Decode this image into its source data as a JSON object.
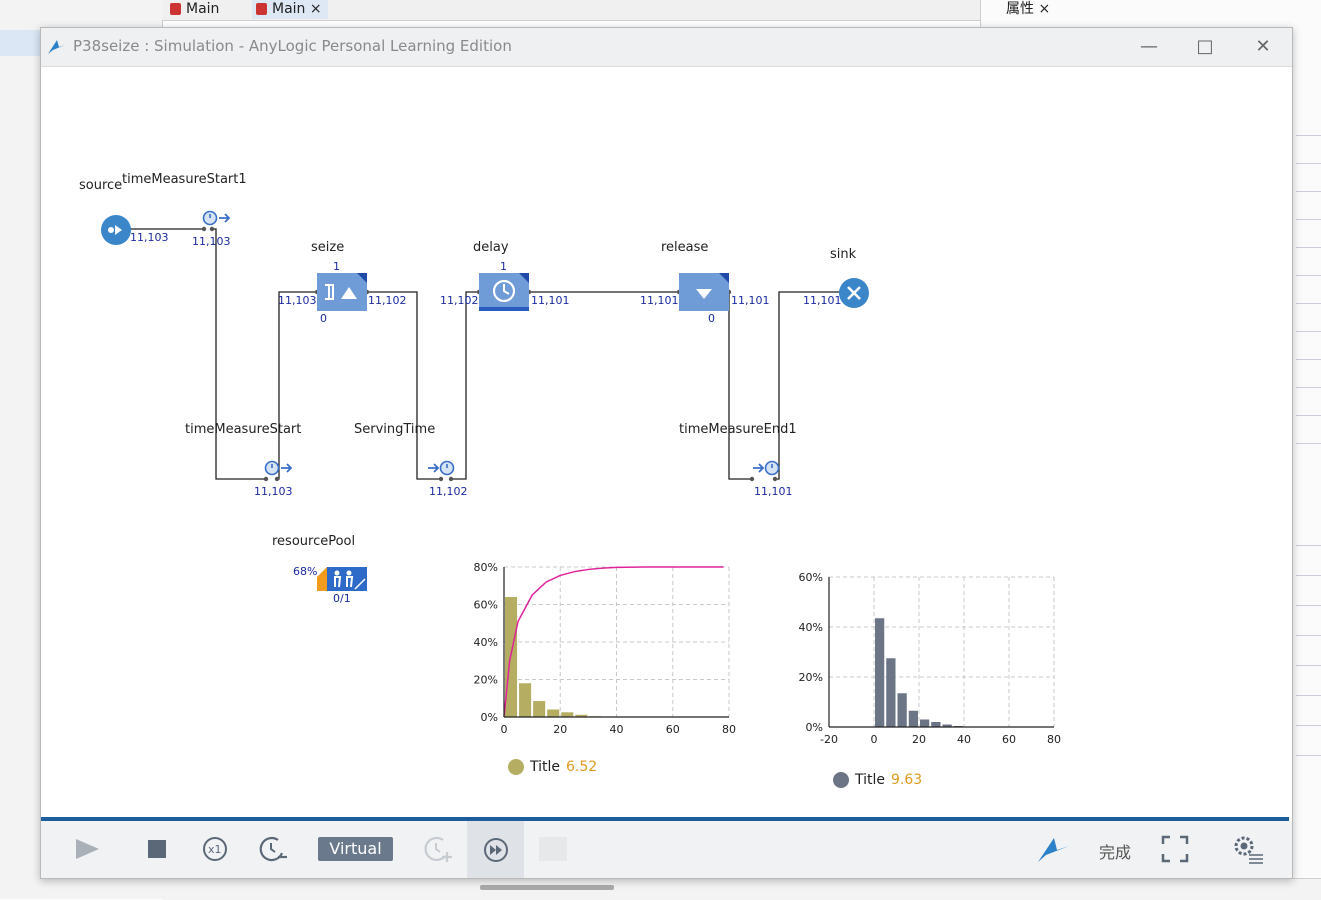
{
  "ide": {
    "tabs": [
      "Main",
      "Main"
    ],
    "right_tab": "属性"
  },
  "window": {
    "title": "P38seize : Simulation - AnyLogic Personal Learning Edition"
  },
  "blocks": {
    "source": {
      "label": "source",
      "count": "11,103"
    },
    "timeMeasureStart1": {
      "label": "timeMeasureStart1",
      "count": "11,103"
    },
    "seize": {
      "label": "seize",
      "top": "1",
      "in": "11,103",
      "out": "11,102",
      "bottom": "0"
    },
    "delay": {
      "label": "delay",
      "top": "1",
      "in": "11,102",
      "out": "11,101"
    },
    "release": {
      "label": "release",
      "in": "11,101",
      "out": "11,101",
      "bottom": "0"
    },
    "sink": {
      "label": "sink",
      "in": "11,101"
    },
    "timeMeasureStart": {
      "label": "timeMeasureStart",
      "count": "11,103"
    },
    "ServingTime": {
      "label": "ServingTime",
      "count": "11,102"
    },
    "timeMeasureEnd1": {
      "label": "timeMeasureEnd1",
      "count": "11,101"
    },
    "resourcePool": {
      "label": "resourcePool",
      "util": "68%",
      "ratio": "0/1"
    }
  },
  "toolbar": {
    "virtual_label": "Virtual",
    "done_label": "完成"
  },
  "chart_data": [
    {
      "type": "bar",
      "title": "",
      "x": [
        2.5,
        7.5,
        12.5,
        17.5,
        22.5,
        27.5,
        32.5,
        37.5
      ],
      "values": [
        64,
        18,
        8.5,
        4,
        2.5,
        1.2,
        0.4,
        0.2
      ],
      "cdf_x": [
        0,
        2,
        5,
        10,
        15,
        20,
        25,
        30,
        35,
        40,
        50,
        60,
        70,
        78
      ],
      "cdf_y": [
        0,
        30,
        51,
        65,
        72,
        75.5,
        77.5,
        78.7,
        79.4,
        79.8,
        80,
        80,
        80,
        80
      ],
      "xlim": [
        0,
        80
      ],
      "ylim": [
        0,
        80
      ],
      "xticks": [
        "0",
        "20",
        "40",
        "60",
        "80"
      ],
      "yticks": [
        "0%",
        "20%",
        "40%",
        "60%",
        "80%"
      ],
      "legend": {
        "label": "Title",
        "value": "6.52"
      },
      "bar_color": "#b5ad62",
      "line_color": "#e0239b",
      "grid": true
    },
    {
      "type": "bar",
      "title": "",
      "x": [
        2.5,
        7.5,
        12.5,
        17.5,
        22.5,
        27.5,
        32.5,
        37.5,
        42.5,
        47.5
      ],
      "values": [
        43.5,
        27.5,
        13.5,
        6.5,
        3,
        2,
        1,
        0.4,
        0.2,
        0.1
      ],
      "xlim": [
        -20,
        80
      ],
      "ylim": [
        0,
        60
      ],
      "xticks": [
        "-20",
        "0",
        "20",
        "40",
        "60",
        "80"
      ],
      "yticks": [
        "0%",
        "20%",
        "40%",
        "60%"
      ],
      "legend": {
        "label": "Title",
        "value": "9.63"
      },
      "bar_color": "#6b7585",
      "grid": true
    }
  ]
}
